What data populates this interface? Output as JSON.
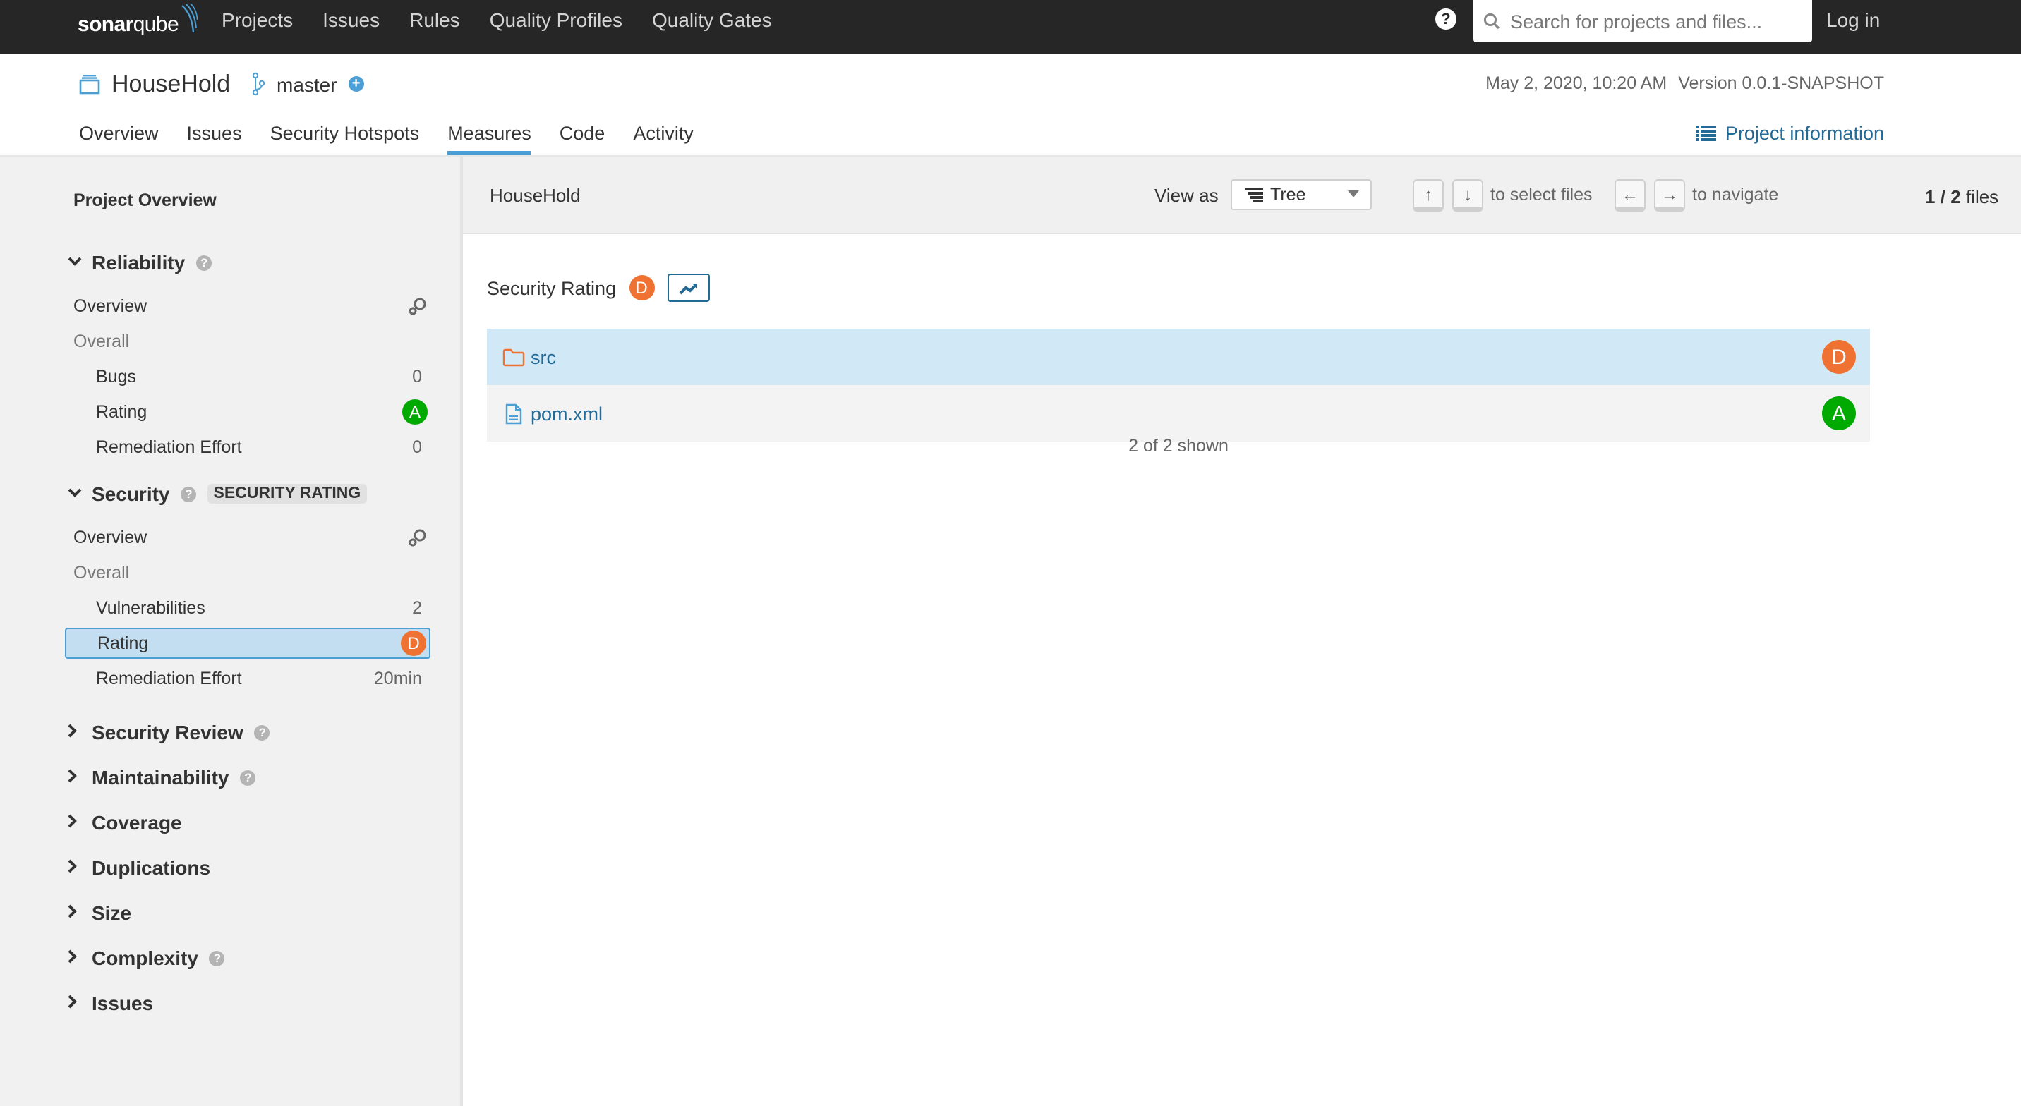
{
  "topnav": {
    "logo": {
      "part1": "sonar",
      "part2": "qube"
    },
    "items": [
      "Projects",
      "Issues",
      "Rules",
      "Quality Profiles",
      "Quality Gates"
    ],
    "help_label": "?",
    "search": {
      "placeholder": "Search for projects and files...",
      "value": ""
    },
    "login_label": "Log in"
  },
  "project": {
    "name": "HouseHold",
    "branch": "master",
    "analysis_date": "May 2, 2020, 10:20 AM",
    "version": "Version 0.0.1-SNAPSHOT",
    "tabs": [
      "Overview",
      "Issues",
      "Security Hotspots",
      "Measures",
      "Code",
      "Activity"
    ],
    "active_tab": "Measures",
    "project_info_label": "Project information"
  },
  "sidebar": {
    "title": "Project Overview",
    "reliability": {
      "name": "Reliability",
      "overview_label": "Overview",
      "overall_label": "Overall",
      "items": [
        {
          "label": "Bugs",
          "value": "0"
        },
        {
          "label": "Rating",
          "rating": "A"
        },
        {
          "label": "Remediation Effort",
          "value": "0"
        }
      ]
    },
    "security": {
      "name": "Security",
      "tag": "SECURITY RATING",
      "overview_label": "Overview",
      "overall_label": "Overall",
      "items": [
        {
          "label": "Vulnerabilities",
          "value": "2"
        },
        {
          "label": "Rating",
          "rating": "D",
          "selected": true
        },
        {
          "label": "Remediation Effort",
          "value": "20min"
        }
      ]
    },
    "collapsed": [
      {
        "name": "Security Review",
        "help": true
      },
      {
        "name": "Maintainability",
        "help": true
      },
      {
        "name": "Coverage",
        "help": false
      },
      {
        "name": "Duplications",
        "help": false
      },
      {
        "name": "Size",
        "help": false
      },
      {
        "name": "Complexity",
        "help": true
      },
      {
        "name": "Issues",
        "help": false
      }
    ]
  },
  "main": {
    "breadcrumb": "HouseHold",
    "view_as_label": "View as",
    "view_as_value": "Tree",
    "keys": {
      "up": "↑",
      "down": "↓",
      "left": "←",
      "right": "→"
    },
    "select_hint": "to select files",
    "navigate_hint": "to navigate",
    "file_count": {
      "current": "1",
      "total": "2",
      "suffix": "files"
    },
    "measure_name": "Security Rating",
    "measure_rating": "D",
    "files": [
      {
        "name": "src",
        "type": "folder",
        "rating": "D"
      },
      {
        "name": "pom.xml",
        "type": "file",
        "rating": "A"
      }
    ],
    "shown_label": "2 of 2 shown"
  },
  "colors": {
    "rating_A": "#00aa00",
    "rating_D": "#f07233",
    "accent": "#4b9fd5",
    "link": "#236a97",
    "topbar": "#262626"
  }
}
